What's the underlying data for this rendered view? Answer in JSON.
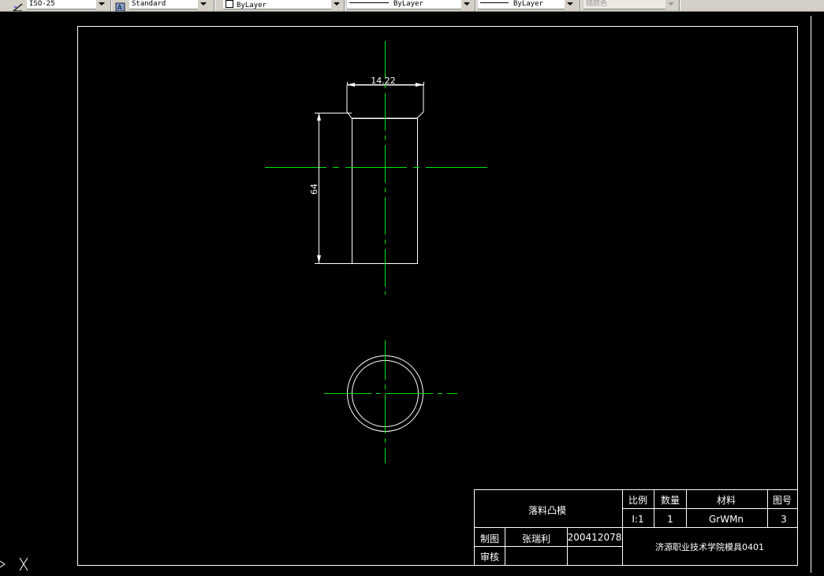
{
  "toolbar": {
    "dimstyle": "ISO-25",
    "textstyle": "Standard",
    "layer": "ByLayer",
    "linetype": "ByLayer",
    "lineweight": "ByLayer",
    "plotstyle": "随颜色"
  },
  "drawing": {
    "dim_width": "14.22",
    "dim_height": "64"
  },
  "title_block": {
    "part_name": "落料凸模",
    "scale_label": "比例",
    "scale_value": "I:1",
    "quantity_label": "数量",
    "quantity_value": "1",
    "material_label": "材料",
    "material_value": "GrWMn",
    "drawing_no_label": "图号",
    "drawing_no_value": "3",
    "drawn_label": "制图",
    "drawn_by": "张瑞利",
    "drawn_id": "200412078",
    "checked_label": "审核",
    "school": "济源职业技术学院模具0401"
  },
  "colors": {
    "background": "#000000",
    "geometry": "#ffffff",
    "centerline": "#00e000",
    "toolbar": "#d4d0c8"
  },
  "icons": [
    "dimstyle-icon",
    "textstyle-icon",
    "ucs-icon"
  ]
}
